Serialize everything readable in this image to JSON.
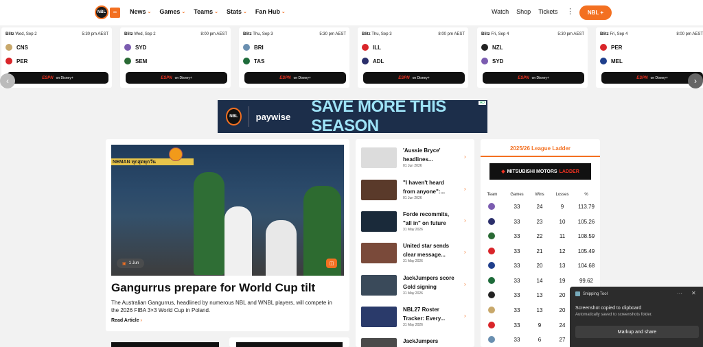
{
  "nav": {
    "logo_text": "NBL",
    "menu": [
      "News",
      "Games",
      "Teams",
      "Stats",
      "Fan Hub"
    ],
    "right_links": [
      "Watch",
      "Shop",
      "Tickets"
    ],
    "more_icon": "⋮",
    "cta": "NBL +"
  },
  "games": [
    {
      "comp": "Blitz",
      "date": "Wed, Sep 2",
      "time": "5:30 pm AEST",
      "home": "CNS",
      "away": "PER",
      "home_color": "#c8a86b",
      "away_color": "#d9252a",
      "broadcast": "ESPN on Disney+"
    },
    {
      "comp": "Blitz",
      "date": "Wed, Sep 2",
      "time": "8:00 pm AEST",
      "home": "SYD",
      "away": "SEM",
      "home_color": "#7b5cb0",
      "away_color": "#2a6a35",
      "broadcast": "ESPN on Disney+"
    },
    {
      "comp": "Blitz",
      "date": "Thu, Sep 3",
      "time": "5:30 pm AEST",
      "home": "BRI",
      "away": "TAS",
      "home_color": "#6a8fb0",
      "away_color": "#1e6b3a",
      "broadcast": "ESPN on Disney+"
    },
    {
      "comp": "Blitz",
      "date": "Thu, Sep 3",
      "time": "8:00 pm AEST",
      "home": "ILL",
      "away": "ADL",
      "home_color": "#d9252a",
      "away_color": "#2b2f6b",
      "broadcast": "ESPN on Disney+"
    },
    {
      "comp": "Blitz",
      "date": "Fri, Sep 4",
      "time": "5:30 pm AEST",
      "home": "NZL",
      "away": "SYD",
      "home_color": "#222222",
      "away_color": "#7b5cb0",
      "broadcast": "ESPN on Disney+"
    },
    {
      "comp": "Blitz",
      "date": "Fri, Sep 4",
      "time": "8:00 pm AEST",
      "home": "PER",
      "away": "MEL",
      "home_color": "#d9252a",
      "away_color": "#1f3f8c",
      "broadcast": "ESPN on Disney+"
    }
  ],
  "banner": {
    "logo": "NBL",
    "brand": "paywise",
    "headline": "SAVE MORE THIS SEASON",
    "ad_tag": "AD"
  },
  "feature": {
    "date": "1 Jun",
    "sign_text": "NEMAN ทุกสุดทุกวัน",
    "title": "Gangurrus prepare for World Cup tilt",
    "description": "The Australian Gangurrus, headlined by numerous NBL and WNBL players, will compete in the 2026 FIBA 3×3 World Cup in Poland.",
    "read_more": "Read Article"
  },
  "news": [
    {
      "title": "'Aussie Bryce' headlines...",
      "date": "01 Jun 2026",
      "thumb": "#dcdcdc"
    },
    {
      "title": "\"I haven't heard from anyone\":...",
      "date": "01 Jun 2026",
      "thumb": "#5a3a2a"
    },
    {
      "title": "Forde recommits, \"all in\" on future",
      "date": "31 May 2026",
      "thumb": "#1a2a3a"
    },
    {
      "title": "United star sends clear message...",
      "date": "31 May 2026",
      "thumb": "#7a4a3a"
    },
    {
      "title": "JackJumpers score Gold signing",
      "date": "31 May 2026",
      "thumb": "#3a4a5a"
    },
    {
      "title": "NBL27 Roster Tracker: Every...",
      "date": "31 May 2026",
      "thumb": "#2a3a6a"
    },
    {
      "title": "JackJumpers",
      "date": "",
      "thumb": "#4a4a4a"
    }
  ],
  "ladder": {
    "title": "2025/26 League Ladder",
    "sponsor": "MITSUBISHI MOTORS",
    "sponsor_suffix": "LADDER",
    "headers": [
      "Team",
      "Games",
      "Wins",
      "Losses",
      "%"
    ],
    "rows": [
      {
        "color": "#7b5cb0",
        "games": "33",
        "wins": "24",
        "losses": "9",
        "pct": "113.79"
      },
      {
        "color": "#2b2f6b",
        "games": "33",
        "wins": "23",
        "losses": "10",
        "pct": "105.26"
      },
      {
        "color": "#2a6a35",
        "games": "33",
        "wins": "22",
        "losses": "11",
        "pct": "108.59"
      },
      {
        "color": "#d9252a",
        "games": "33",
        "wins": "21",
        "losses": "12",
        "pct": "105.49"
      },
      {
        "color": "#1f3f8c",
        "games": "33",
        "wins": "20",
        "losses": "13",
        "pct": "104.68"
      },
      {
        "color": "#1e6b3a",
        "games": "33",
        "wins": "14",
        "losses": "19",
        "pct": "99.62"
      },
      {
        "color": "#222222",
        "games": "33",
        "wins": "13",
        "losses": "20",
        "pct": ""
      },
      {
        "color": "#c8a86b",
        "games": "33",
        "wins": "13",
        "losses": "20",
        "pct": ""
      },
      {
        "color": "#d9252a",
        "games": "33",
        "wins": "9",
        "losses": "24",
        "pct": ""
      },
      {
        "color": "#6a8fb0",
        "games": "33",
        "wins": "6",
        "losses": "27",
        "pct": ""
      }
    ]
  },
  "toast": {
    "app": "Snipping Tool",
    "message": "Screenshot copied to clipboard",
    "sub": "Automatically saved to screenshots folder.",
    "action": "Markup and share"
  },
  "colors": {
    "accent": "#f37021",
    "dark": "#111111"
  }
}
